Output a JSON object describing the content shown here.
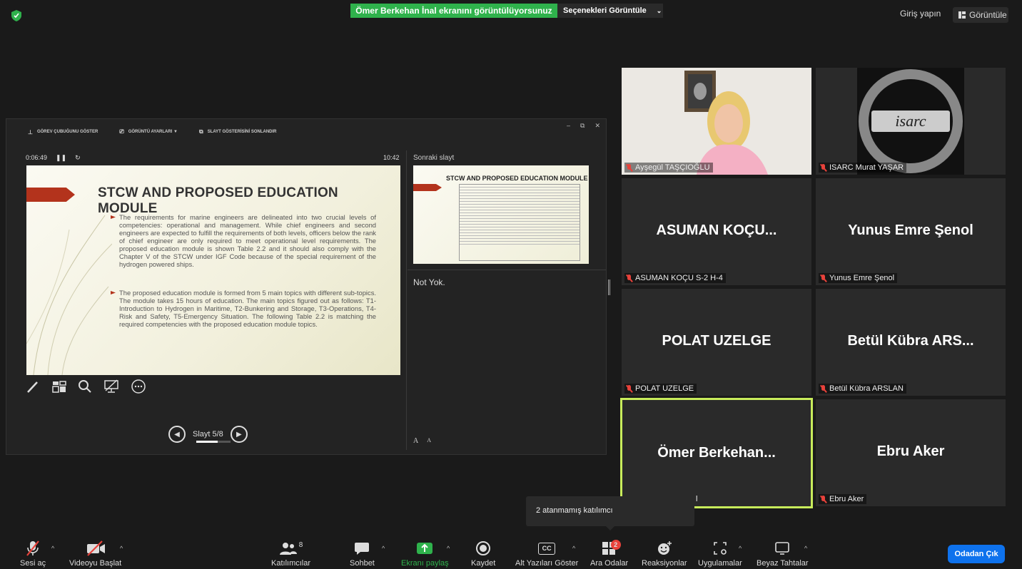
{
  "topbar": {
    "share_banner": "Ömer Berkehan İnal ekranını görüntülüyorsunuz",
    "view_options": "Seçenekleri Görüntüle",
    "sign_in": "Giriş yapın",
    "view_button": "Görüntüle"
  },
  "presenter": {
    "toolbar": {
      "taskbar": "GÖREV ÇUBUĞUNU GÖSTER",
      "display_settings": "GÖRÜNTÜ AYARLARI ▼",
      "end_slideshow": "SLAYT GÖSTERİSİNİ SONLANDIR"
    },
    "timer": "0:06:49",
    "clock": "10:42",
    "next_slide_label": "Sonraki slayt",
    "notes": "Not Yok.",
    "slide_counter": "Slayt 5/8",
    "progress": 0.625,
    "font_size_labels": [
      "A",
      "A"
    ]
  },
  "slide": {
    "title": "STCW AND PROPOSED EDUCATION MODULE",
    "bullets": [
      "The requirements for marine engineers are delineated into two crucial levels of competencies: operational and management. While chief engineers and second engineers are expected to fulfill the requirements of both levels, officers below the rank of chief engineer are only required to meet operational level requirements. The proposed education module is shown Table 2.2 and it should also comply with the Chapter V of the STCW under IGF Code because of the special requirement of the hydrogen powered ships.",
      "The proposed education module is formed from 5 main topics with different sub-topics. The module takes 15 hours of education. The main topics figured out as follows: T1-Introduction to Hydrogen in Maritime, T2-Bunkering and Storage, T3-Operations, T4-Risk and Safety, T5-Emergency Situation. The following Table 2.2 is matching the required competencies with the proposed education module topics."
    ]
  },
  "next_slide": {
    "title": "STCW AND PROPOSED EDUCATION MODULE"
  },
  "participants": [
    {
      "display": "",
      "label": "Ayşegül TAŞÇIOĞLU"
    },
    {
      "display": "",
      "label": "ISARC Murat YAŞAR"
    },
    {
      "display": "ASUMAN  KOÇU...",
      "label": "ASUMAN KOÇU S-2 H-4"
    },
    {
      "display": "Yunus Emre Şenol",
      "label": "Yunus Emre Şenol"
    },
    {
      "display": "POLAT UZELGE",
      "label": "POLAT UZELGE"
    },
    {
      "display": "Betül  Kübra  ARS...",
      "label": "Betül Kübra ARSLAN"
    },
    {
      "display": "Ömer  Berkehan...",
      "label": "l"
    },
    {
      "display": "Ebru Aker",
      "label": "Ebru Aker"
    }
  ],
  "tooltip": "2 atanmamış katılımcı",
  "toolbar": {
    "unmute": "Sesi aç",
    "start_video": "Videoyu Başlat",
    "participants": "Katılımcılar",
    "participants_count": "8",
    "chat": "Sohbet",
    "share_screen": "Ekranı paylaş",
    "record": "Kaydet",
    "captions": "Alt Yazıları Göster",
    "breakout": "Ara Odalar",
    "breakout_badge": "2",
    "reactions": "Reaksiyonlar",
    "apps": "Uygulamalar",
    "whiteboards": "Beyaz Tahtalar",
    "leave": "Odadan Çık",
    "captions_icon_text": "CC"
  },
  "colors": {
    "share_green": "#2fb24c",
    "active_speaker": "#c8ec5b",
    "leave_blue": "#0e72ed",
    "mute_red": "#e8423b",
    "slide_accent": "#b3331c"
  },
  "icons": [
    "shield-icon",
    "grid-icon",
    "pen-icon",
    "layout-icon",
    "magnifier-icon",
    "screen-off-icon",
    "more-icon",
    "mic-off-icon",
    "video-off-icon",
    "participants-icon",
    "chat-icon",
    "share-arrow-icon",
    "record-icon",
    "cc-icon",
    "breakout-icon",
    "reaction-icon",
    "apps-icon",
    "whiteboard-icon"
  ]
}
